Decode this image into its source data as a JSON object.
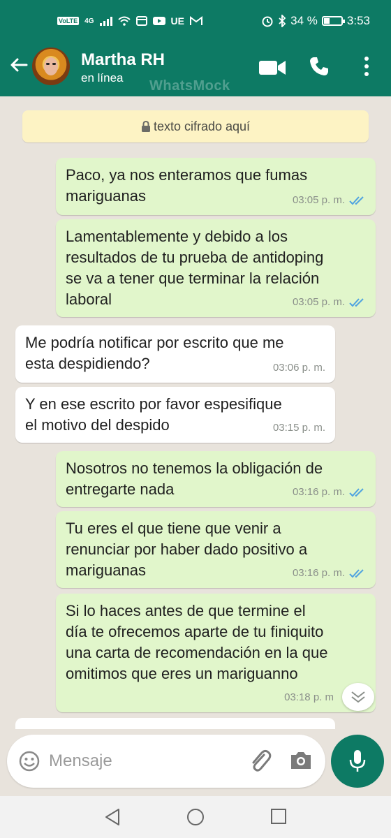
{
  "status_bar": {
    "left_text": "UE",
    "volte": "VoLTE",
    "network": "4G",
    "battery_text": "34 %",
    "battery_level": 0.34,
    "time": "3:53"
  },
  "header": {
    "contact_name": "Martha RH",
    "contact_status": "en línea",
    "watermark": "WhatsMock"
  },
  "chat": {
    "encryption_notice": "texto cifrado aquí",
    "messages": [
      {
        "direction": "out",
        "text": "Paco, ya nos enteramos que fumas\nmariguanas",
        "time": "03:05 p. m.",
        "read": true
      },
      {
        "direction": "out",
        "text": "Lamentablemente y debido a los\nresultados de tu prueba de antidoping\nse va a tener que terminar la relación\nlaboral",
        "time": "03:05 p. m.",
        "read": true
      },
      {
        "direction": "in",
        "text": "Me podría notificar por escrito que me\nesta despidiendo?",
        "time": "03:06 p. m."
      },
      {
        "direction": "in",
        "text": "Y en ese escrito por favor espesifique\nel motivo del despido",
        "time": "03:15 p. m."
      },
      {
        "direction": "out",
        "text": "Nosotros no tenemos la obligación de\nentregarte nada",
        "time": "03:16 p. m.",
        "read": true
      },
      {
        "direction": "out",
        "text": "Tu eres el que tiene que venir a\nrenunciar por haber dado positivo a\nmariguanas",
        "time": "03:16 p. m.",
        "read": true
      },
      {
        "direction": "out",
        "text": "Si lo haces antes de que termine el\ndía te ofrecemos aparte de tu finiquito\nuna carta de recomendación en la que\nomitimos que eres un mariguanno",
        "time": "03:18 p. m",
        "read": false
      }
    ]
  },
  "input": {
    "placeholder": "Mensaje"
  },
  "colors": {
    "header": "#0d7a64",
    "outgoing_bubble": "#e1f6cb",
    "incoming_bubble": "#ffffff",
    "read_ticks": "#4fa3e0",
    "chat_background": "#e8e3dc"
  },
  "icons": {
    "back": "arrow-left-icon",
    "video": "video-camera-icon",
    "call": "phone-icon",
    "menu": "more-vertical-icon",
    "lock": "lock-icon",
    "emoji": "emoji-icon",
    "attach": "paperclip-icon",
    "camera": "camera-icon",
    "mic": "microphone-icon",
    "scroll": "chevron-double-down-icon",
    "nav_back": "triangle-back-icon",
    "nav_home": "circle-home-icon",
    "nav_recent": "square-recent-icon"
  }
}
